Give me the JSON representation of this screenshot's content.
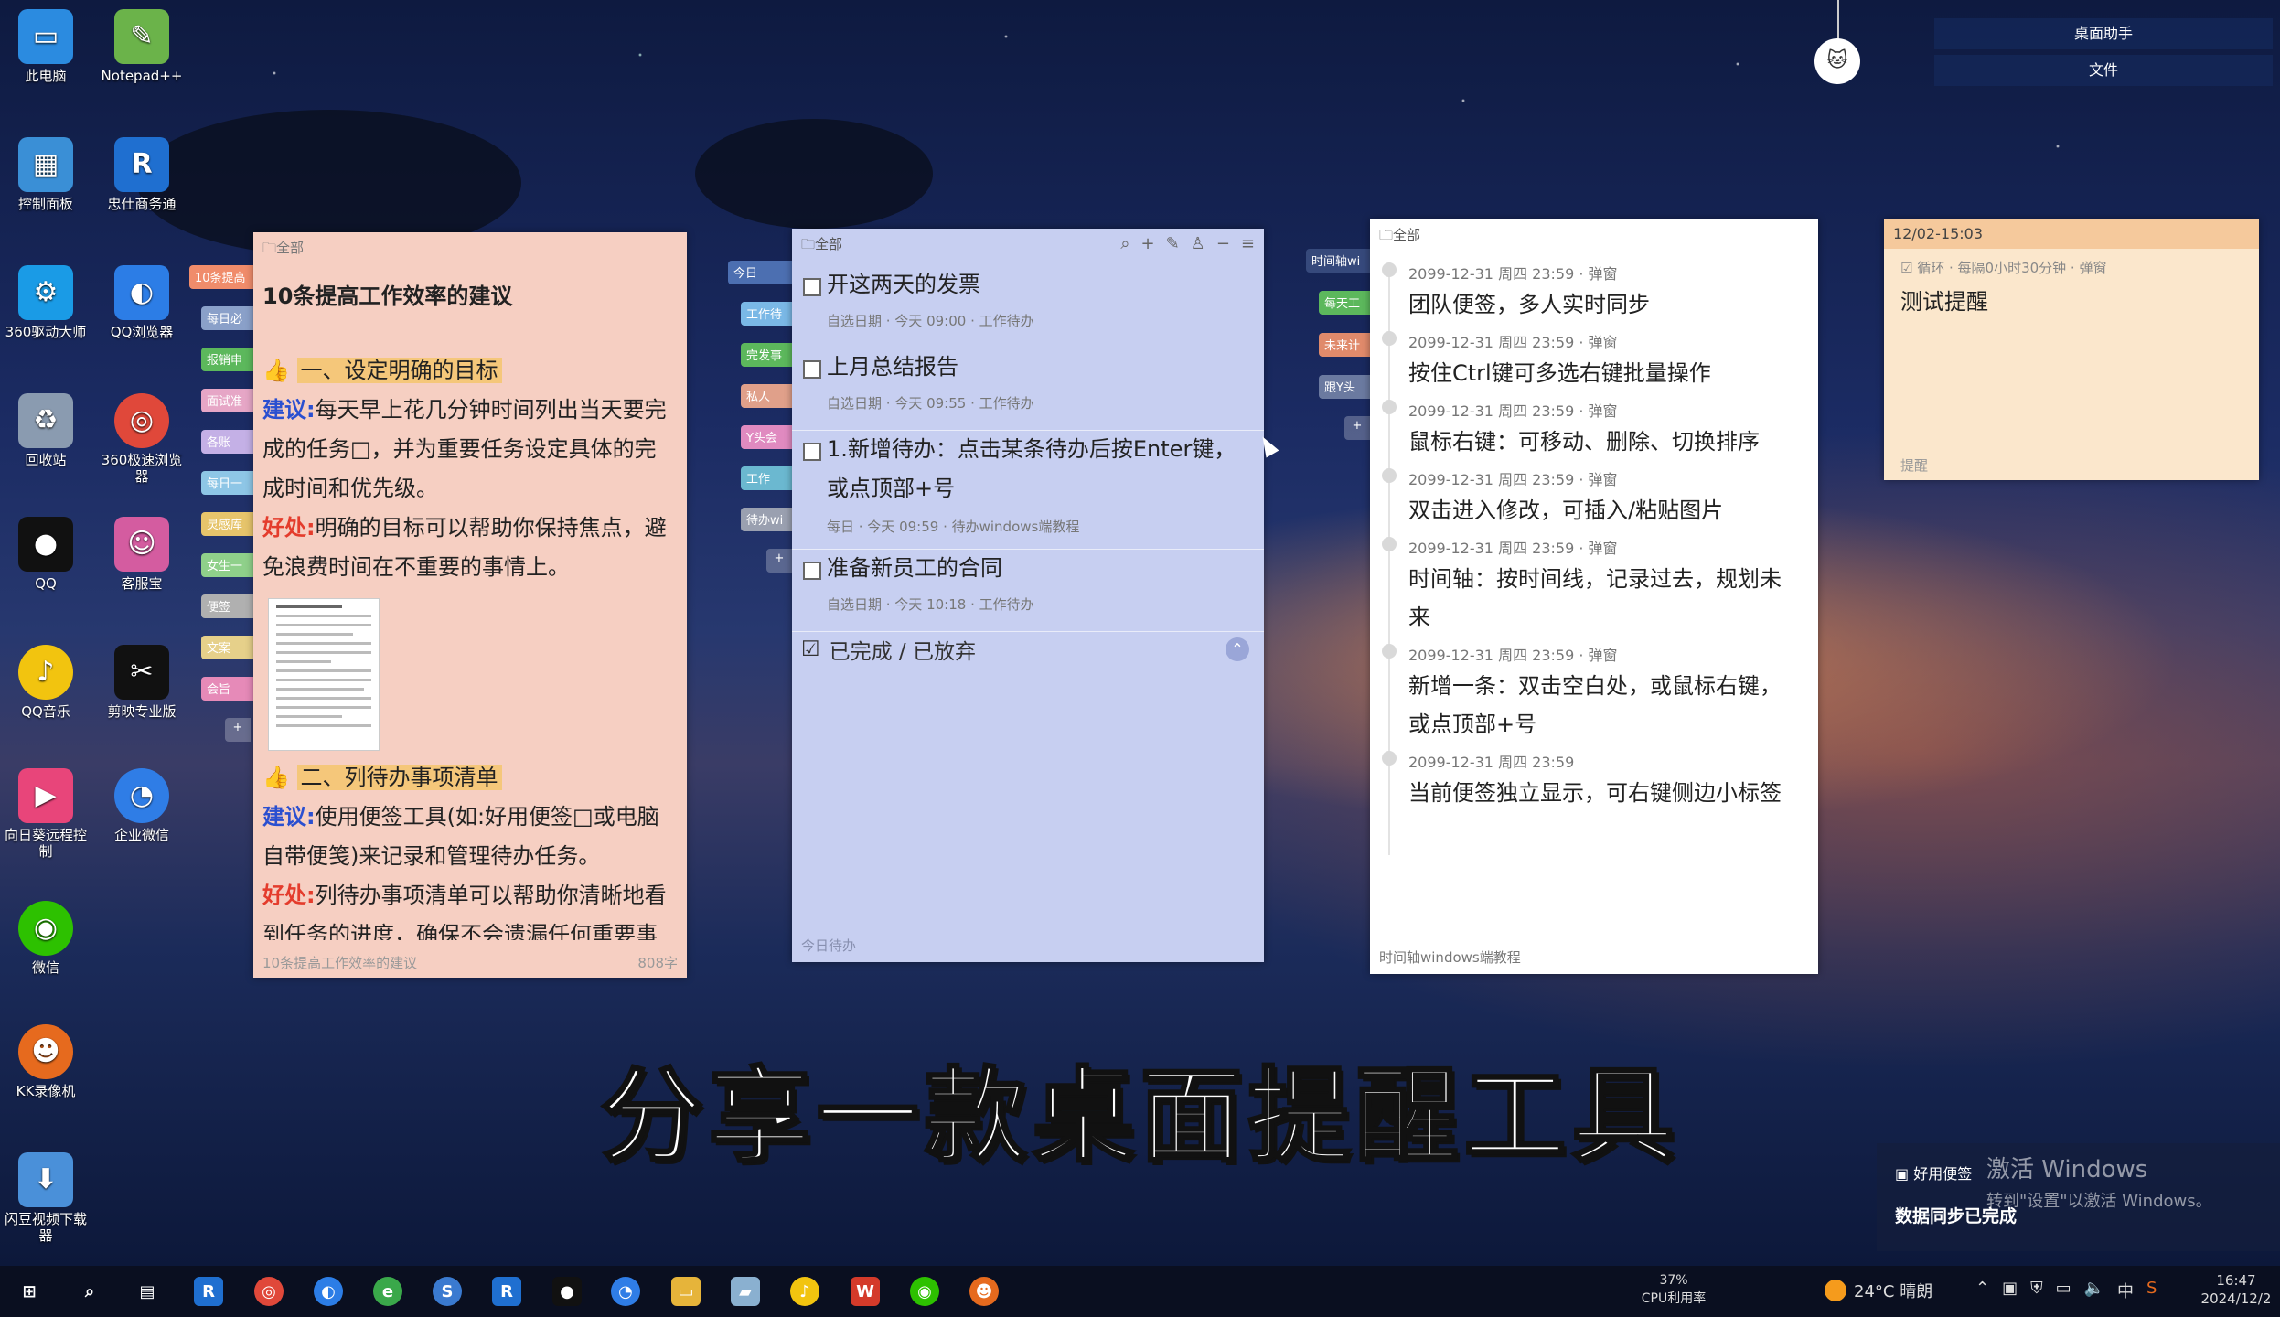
{
  "desktop_icons": [
    {
      "label": "此电脑",
      "icon": "computer-icon",
      "color": "#2b8be0"
    },
    {
      "label": "Notepad++",
      "icon": "notepad-icon",
      "color": "#6bb34a"
    },
    {
      "label": "控制面板",
      "icon": "control-panel-icon",
      "color": "#3a8fd6"
    },
    {
      "label": "忠仕商务通",
      "icon": "r-app-icon",
      "color": "#1f6fd0"
    },
    {
      "label": "360驱动大师",
      "icon": "driver-icon",
      "color": "#1a9be6"
    },
    {
      "label": "QQ浏览器",
      "icon": "qq-browser-icon",
      "color": "#2c7de6"
    },
    {
      "label": "回收站",
      "icon": "recycle-bin-icon",
      "color": "#8a9bb0"
    },
    {
      "label": "360极速浏览器",
      "icon": "browser-360-icon",
      "color": "#e0483a"
    },
    {
      "label": "QQ",
      "icon": "qq-icon",
      "color": "#111111"
    },
    {
      "label": "客服宝",
      "icon": "service-icon",
      "color": "#d45ca0"
    },
    {
      "label": "QQ音乐",
      "icon": "qq-music-icon",
      "color": "#f2c40f"
    },
    {
      "label": "剪映专业版",
      "icon": "capcut-icon",
      "color": "#111111"
    },
    {
      "label": "向日葵远程控制",
      "icon": "sunflower-icon",
      "color": "#e8457a"
    },
    {
      "label": "企业微信",
      "icon": "wecom-icon",
      "color": "#2f7de6"
    },
    {
      "label": "微信",
      "icon": "wechat-icon",
      "color": "#2dc100"
    },
    {
      "label": "KK录像机",
      "icon": "kk-recorder-icon",
      "color": "#e66a1e"
    },
    {
      "label": "闪豆视频下载器",
      "icon": "video-download-icon",
      "color": "#4a90d9"
    }
  ],
  "note_panel": {
    "breadcrumb": "全部",
    "title": "10条提高工作效率的建议",
    "section1_heading": "一、设定明确的目标",
    "section1_advice_label": "建议:",
    "section1_advice": "每天早上花几分钟时间列出当天要完成的任务□，并为重要任务设定具体的完成时间和优先级。",
    "section1_benefit_label": "好处:",
    "section1_benefit": "明确的目标可以帮助你保持焦点，避免浪费时间在不重要的事情上。",
    "section2_heading": "二、列待办事项清单",
    "section2_advice_label": "建议:",
    "section2_advice": "使用便签工具(如:好用便签□或电脑自带便笺)来记录和管理待办任务。",
    "section2_benefit_label": "好处:",
    "section2_benefit": "列待办事项清单可以帮助你清晰地看到任务的进度，确保不会遗漏任何重要事",
    "footer_title": "10条提高工作效率的建议",
    "footer_count": "808字"
  },
  "note_side_tabs": [
    "10条提高",
    "每日必",
    "报销申",
    "面试准",
    "各账",
    "每日一",
    "灵感库",
    "女生一",
    "便签",
    "文案",
    "会旨"
  ],
  "todo_side_tabs": [
    "今日",
    "工作待",
    "完发事",
    "私人",
    "Y头会",
    "工作",
    "待办wi"
  ],
  "timeline_side_tabs": [
    "时间轴wi",
    "每天工",
    "未来计",
    "跟Y头"
  ],
  "todo_panel": {
    "breadcrumb": "全部",
    "items": [
      {
        "text": "开这两天的发票",
        "meta": "自选日期 · 今天 09:00 · 工作待办"
      },
      {
        "text": "上月总结报告",
        "meta": "自选日期 · 今天 09:55 · 工作待办"
      },
      {
        "text": "1.新增待办：点击某条待办后按Enter键，或点顶部+号",
        "meta": "每日 · 今天 09:59 · 待办windows端教程"
      },
      {
        "text": "准备新员工的合同",
        "meta": "自选日期 · 今天 10:18 · 工作待办"
      }
    ],
    "done_label": "已完成 / 已放弃",
    "footer": "今日待办"
  },
  "timeline_panel": {
    "breadcrumb": "全部",
    "entries": [
      {
        "meta": "2099-12-31 周四 23:59 · 弹窗",
        "text": "团队便签，多人实时同步"
      },
      {
        "meta": "2099-12-31 周四 23:59 · 弹窗",
        "text": "按住Ctrl键可多选右键批量操作"
      },
      {
        "meta": "2099-12-31 周四 23:59 · 弹窗",
        "text": "鼠标右键：可移动、删除、切换排序"
      },
      {
        "meta": "2099-12-31 周四 23:59 · 弹窗",
        "text": "双击进入修改，可插入/粘贴图片"
      },
      {
        "meta": "2099-12-31 周四 23:59 · 弹窗",
        "text": "时间轴：按时间线，记录过去，规划未来"
      },
      {
        "meta": "2099-12-31 周四 23:59 · 弹窗",
        "text": "新增一条：双击空白处，或鼠标右键，或点顶部+号"
      },
      {
        "meta": "2099-12-31 周四 23:59",
        "text": "当前便签独立显示，可右键侧边小标签"
      }
    ],
    "footer": "时间轴windows端教程"
  },
  "remind_panel": {
    "header": "12/02-15:03",
    "meta": "循环 · 每隔0小时30分钟 · 弹窗",
    "title": "测试提醒",
    "footer": "提醒"
  },
  "helper_widget": {
    "title": "桌面助手",
    "file": "文件"
  },
  "caption": "分享一款桌面提醒工具",
  "toast": {
    "app": "好用便签",
    "message": "数据同步已完成"
  },
  "watermark": {
    "line1": "激活 Windows",
    "line2": "转到\"设置\"以激活 Windows。"
  },
  "taskbar": {
    "cpu_percent": "37%",
    "cpu_label": "CPU利用率",
    "weather": "24°C 晴朗",
    "ime": "中",
    "time": "16:47",
    "date": "2024/12/2"
  }
}
